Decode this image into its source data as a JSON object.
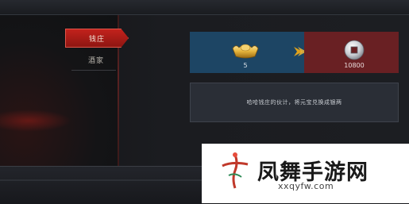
{
  "tabs": [
    {
      "label": "钱庄",
      "active": true
    },
    {
      "label": "酒家",
      "active": false
    }
  ],
  "exchange": {
    "from_amount": "5",
    "to_amount": "10800",
    "from_icon": "gold-ingot-icon",
    "to_icon": "silver-coin-icon",
    "arrow_icon": "arrow-right-icon"
  },
  "description": "哈哈钱庄的伙计，将元宝兑换成银两",
  "watermark": {
    "title": "凤舞手游网",
    "url": "xxqyfw.com"
  },
  "colors": {
    "accent_red": "#c2221c",
    "card_blue": "#1d4564",
    "card_red": "#692023",
    "arrow_gold": "#e0a21c"
  }
}
